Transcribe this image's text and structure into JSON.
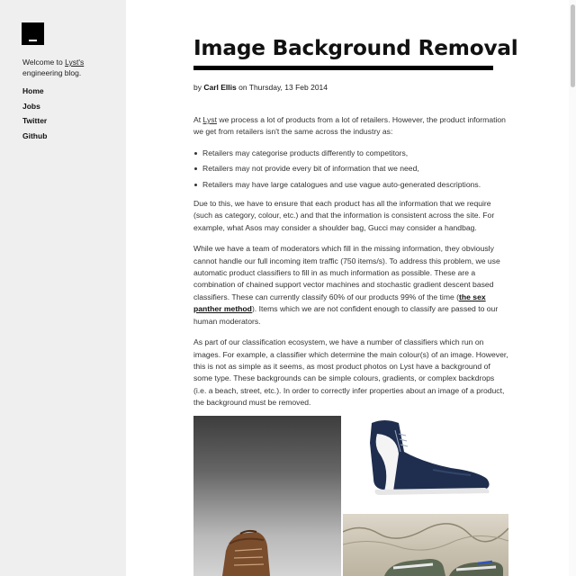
{
  "sidebar": {
    "welcome_prefix": "Welcome to ",
    "welcome_link": "Lyst's",
    "welcome_suffix": " engineering blog.",
    "nav": [
      "Home",
      "Jobs",
      "Twitter",
      "Github"
    ]
  },
  "post": {
    "title": "Image Background Removal",
    "byline_prefix": "by ",
    "author": "Carl Ellis",
    "date_text": " on Thursday, 13 Feb 2014",
    "p1_prefix": "At ",
    "p1_link": "Lyst",
    "p1_suffix": " we process a lot of products from a lot of retailers. However, the product information we get from retailers isn't the same across the industry as:",
    "bullets": [
      "Retailers may categorise products differently to competitors,",
      "Retailers may not provide every bit of information that we need,",
      "Retailers may have large catalogues and use vague auto-generated descriptions."
    ],
    "p2": "Due to this, we have to ensure that each product has all the information that we require (such as category, colour, etc.) and that the information is consistent across the site. For example, what Asos may consider a shoulder bag, Gucci may consider a handbag.",
    "p3_before": "While we have a team of moderators which fill in the missing information, they obviously cannot handle our full incoming item traffic (750 items/s). To address this problem, we use automatic product classifiers to fill in as much information as possible. These are a combination of chained support vector machines and stochastic gradient descent based classifiers. These can currently classify 60% of our products 99% of the time (",
    "p3_link": "the sex panther method",
    "p3_after": "). Items which we are not confident enough to classify are passed to our human moderators.",
    "p4": "As part of our classification ecosystem, we have a number of classifiers which run on images. For example, a classifier which determine the main colour(s) of an image. However, this is not as simple as it seems, as most product photos on Lyst have a background of some type. These backgrounds can be simple colours, gradients, or complex backdrops (i.e. a beach, street, etc.). In order to correctly infer properties about an image of a product, the background must be removed."
  },
  "colors": {
    "sidebar_bg": "#efefef",
    "text": "#333333",
    "rule": "#000000"
  },
  "icons": {
    "logo": "lyst-logo-icon"
  }
}
